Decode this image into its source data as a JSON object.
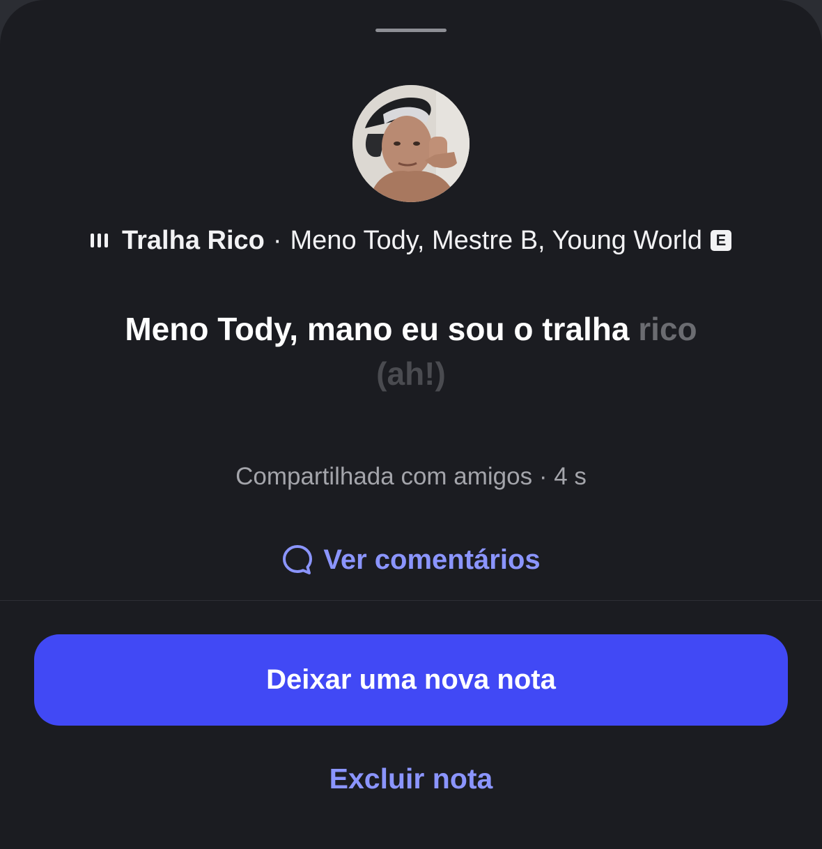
{
  "track": {
    "title": "Tralha Rico",
    "separator": "·",
    "artists": "Meno Tody, Mestre B, Young World",
    "explicit_badge": "E"
  },
  "lyrics": {
    "active": "Meno Tody, mano eu sou o tralha",
    "upcoming": "rico",
    "next_line": "(ah!)"
  },
  "shared": {
    "text": "Compartilhada com amigos · 4 s"
  },
  "actions": {
    "comments_label": "Ver comentários",
    "new_note_label": "Deixar uma nova nota",
    "delete_label": "Excluir nota"
  },
  "icons": {
    "equalizer": "audio-bars-icon",
    "comment": "speech-bubble-icon"
  },
  "colors": {
    "background": "#1b1c21",
    "accent": "#4149f5",
    "link": "#8b95ff",
    "text_primary": "#ffffff",
    "text_secondary": "#a4a5ab"
  }
}
